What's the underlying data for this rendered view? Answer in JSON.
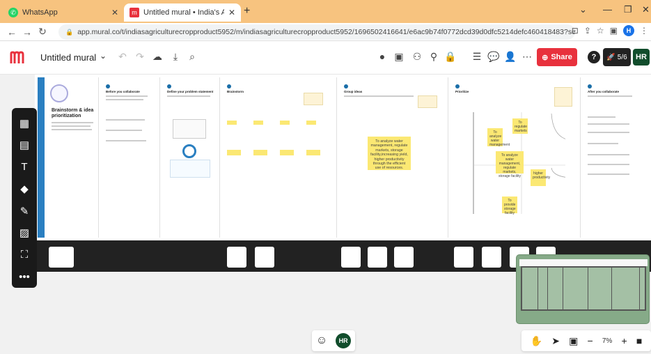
{
  "browser": {
    "tabs": [
      {
        "label": "WhatsApp",
        "active": false
      },
      {
        "label": "Untitled mural • India's Agricult…",
        "active": true
      }
    ],
    "url": "app.mural.co/t/indiasagriculturecropproduct5952/m/indiasagriculturecropproduct5952/1696502416641/e6ac9b74f0772dcd39d0dfc5214defc460418483?sender=u…",
    "new_tab": "+",
    "profile_initial": "H"
  },
  "mural": {
    "title": "Untitled mural",
    "share_label": "Share",
    "rocket_label": "5/6",
    "user_initials": "HR"
  },
  "board": {
    "intro_title": "Brainstorm & idea prioritization",
    "panels": [
      {
        "title": "Before you collaborate"
      },
      {
        "title": "Define your problem statement"
      },
      {
        "title": "Brainstorm"
      },
      {
        "title": "Group ideas"
      },
      {
        "title": "Prioritize"
      },
      {
        "title": "After you collaborate"
      }
    ],
    "group_note": "To analyze water management, regulate markets, storage facility,increasing yield, higher productivity through the efficient use of resources.",
    "prioritize_notes": [
      "To analyze water management",
      "To regulate markets",
      "To analyze water management, regulate markets, storage facility",
      "higher productivity",
      "To provide storage facility",
      "efficient use of resources"
    ]
  },
  "bottom": {
    "avatar_initials": "HR",
    "zoom": "7%"
  },
  "colors": {
    "tabbar": "#f7c37f",
    "share": "#e8313d",
    "sticky": "#fbe873",
    "minimap": "#86aa88",
    "accent_blue": "#2a7fc1"
  }
}
